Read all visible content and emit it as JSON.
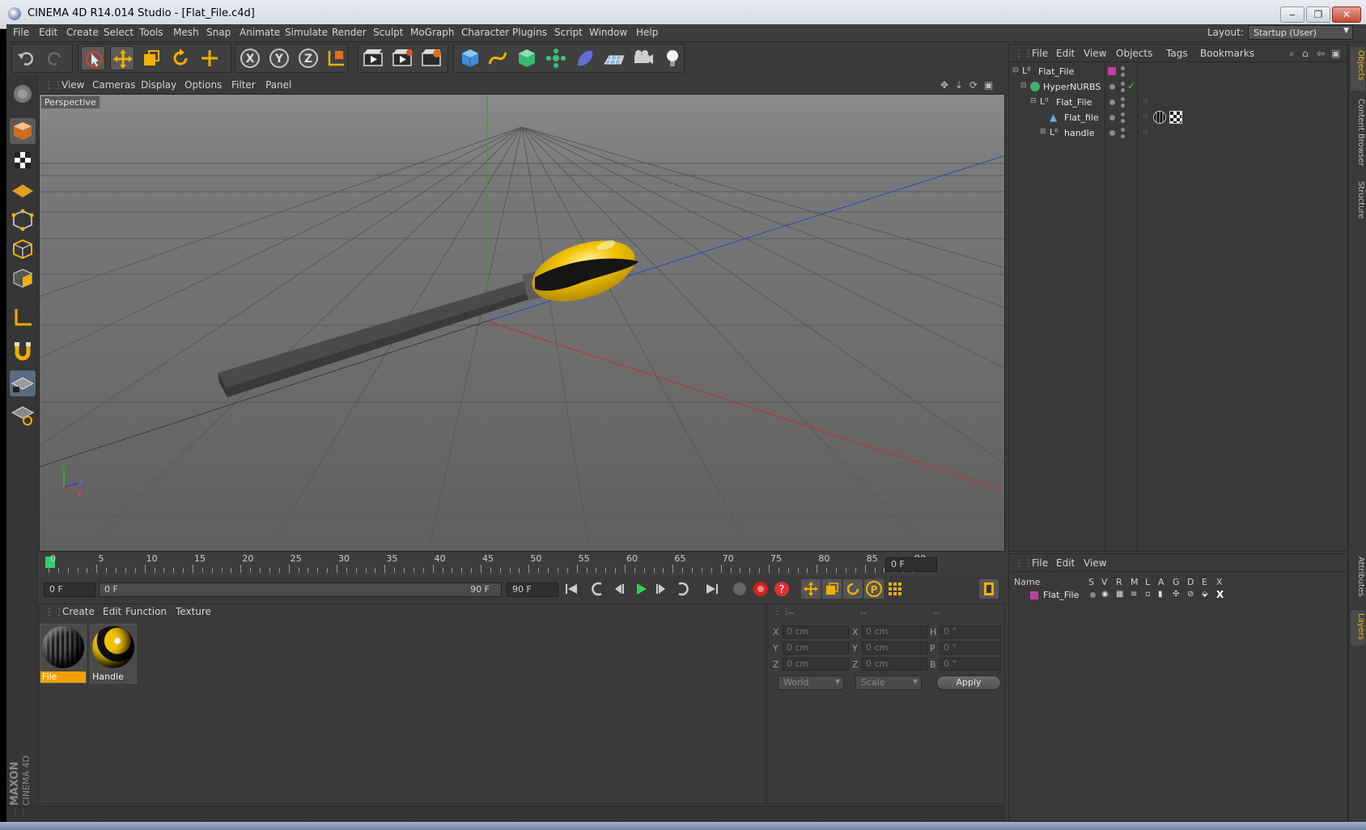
{
  "window": {
    "title": "CINEMA 4D R14.014 Studio - [Flat_File.c4d]",
    "buttons": [
      "minimize",
      "restore",
      "close"
    ]
  },
  "menubar": {
    "items": [
      "File",
      "Edit",
      "Create",
      "Select",
      "Tools",
      "Mesh",
      "Snap",
      "Animate",
      "Simulate",
      "Render",
      "Sculpt",
      "MoGraph",
      "Character",
      "Plugins",
      "Script",
      "Window",
      "Help"
    ],
    "layout_label": "Layout:",
    "layout_value": "Startup (User)"
  },
  "toolbar": {
    "icons": [
      "undo-icon",
      "redo-icon",
      "live-selection-icon",
      "move-icon",
      "scale-icon",
      "rotate-icon",
      "last-tool-icon",
      "x-axis-icon",
      "y-axis-icon",
      "z-axis-icon",
      "world-coord-icon",
      "render-view-icon",
      "render-picture-viewer-icon",
      "edit-render-settings-icon",
      "cube-icon",
      "spline-pen-icon",
      "nurbs-icon",
      "array-icon",
      "deformer-icon",
      "floor-icon",
      "camera-icon",
      "light-icon"
    ]
  },
  "viewport": {
    "menu": [
      "View",
      "Cameras",
      "Display",
      "Options",
      "Filter",
      "Panel"
    ],
    "label": "Perspective"
  },
  "timeline": {
    "ticks": [
      "0",
      "5",
      "10",
      "15",
      "20",
      "25",
      "30",
      "35",
      "40",
      "45",
      "50",
      "55",
      "60",
      "65",
      "70",
      "75",
      "80",
      "85",
      "90"
    ],
    "current_frame": "0 F",
    "start_field": "0 F",
    "range_start": "0 F",
    "range_end": "90 F",
    "end_field": "90 F"
  },
  "materials": {
    "menu": [
      "Create",
      "Edit",
      "Function",
      "Texture"
    ],
    "items": [
      {
        "name": "File",
        "active": true
      },
      {
        "name": "Handle",
        "active": false
      }
    ]
  },
  "coordinates": {
    "header": [
      "--",
      "--",
      "--"
    ],
    "rows": [
      {
        "pos_label": "X",
        "pos": "0 cm",
        "size_label": "X",
        "size": "0 cm",
        "rot_label": "H",
        "rot": "0 °"
      },
      {
        "pos_label": "Y",
        "pos": "0 cm",
        "size_label": "Y",
        "size": "0 cm",
        "rot_label": "P",
        "rot": "0 °"
      },
      {
        "pos_label": "Z",
        "pos": "0 cm",
        "size_label": "Z",
        "size": "0 cm",
        "rot_label": "B",
        "rot": "0 °"
      }
    ],
    "mode_select": "World",
    "scale_select": "Scale",
    "apply_label": "Apply"
  },
  "objects": {
    "menu": [
      "File",
      "Edit",
      "View",
      "Objects",
      "Tags",
      "Bookmarks"
    ],
    "tree": [
      {
        "name": "Flat_File",
        "type": "null"
      },
      {
        "name": "HyperNURBS",
        "type": "hypernurbs"
      },
      {
        "name": "Flat_File",
        "type": "null"
      },
      {
        "name": "Flat_file",
        "type": "polygon"
      },
      {
        "name": "handle",
        "type": "null"
      }
    ]
  },
  "layers": {
    "menu": [
      "File",
      "Edit",
      "View"
    ],
    "columns": [
      "Name",
      "S",
      "V",
      "R",
      "M",
      "L",
      "A",
      "G",
      "D",
      "E",
      "X"
    ],
    "rows": [
      {
        "name": "Flat_File",
        "color": "#c040a0"
      }
    ]
  },
  "right_tabs": [
    "Objects",
    "Content Browser",
    "Structure",
    "Attributes",
    "Layers"
  ],
  "brand": {
    "maxon": "MAXON",
    "product": "CINEMA 4D"
  },
  "colors": {
    "accent": "#f0a000",
    "axis_x": "#c03030",
    "axis_y": "#30a030",
    "axis_z": "#3040c0",
    "handle_yellow": "#f2c400"
  }
}
